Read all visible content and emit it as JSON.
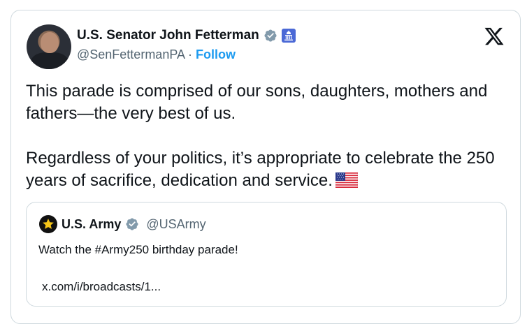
{
  "tweet": {
    "author": {
      "display_name": "U.S. Senator John Fetterman",
      "handle": "@SenFettermanPA",
      "separator": "·",
      "follow_label": "Follow",
      "verified_badge": "verified-gray-check-icon",
      "affiliation_badge": "us-capitol-icon"
    },
    "platform_icon": "x-logo-icon",
    "text_paragraph_1": "This parade is comprised of our sons, daughters, mothers and fathers—the very best of us.",
    "text_paragraph_2": "Regardless of your politics, it’s appropriate to celebrate the 250 years of sacrifice, dedication and service.",
    "emoji": "us-flag-icon"
  },
  "quoted_tweet": {
    "display_name": "U.S. Army",
    "handle": "@USArmy",
    "verified_badge": "verified-gray-check-icon",
    "avatar_icon": "army-star-icon",
    "text": "Watch the #Army250 birthday parade!",
    "link_text": "x.com/i/broadcasts/1..."
  },
  "colors": {
    "link_blue": "#1d9bf0",
    "secondary_text": "#536471",
    "border": "#cfd9de",
    "verified_gray": "#829aab",
    "army_gold": "#f5c518"
  }
}
